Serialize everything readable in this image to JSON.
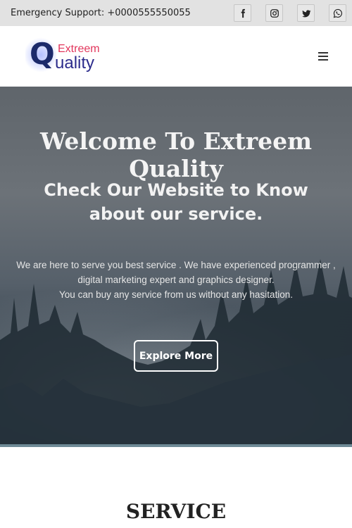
{
  "topbar": {
    "support_text": "Emergency Support: +0000555550055",
    "socials": [
      {
        "name": "facebook-icon"
      },
      {
        "name": "instagram-icon"
      },
      {
        "name": "twitter-icon"
      },
      {
        "name": "whatsapp-icon"
      }
    ]
  },
  "nav": {
    "logo": {
      "letter": "Q",
      "top": "Extreem",
      "bottom": "uality"
    },
    "menu_icon": "hamburger-icon"
  },
  "hero": {
    "title": "Welcome To Extreem Quality",
    "subtitle": "Check Our Website to Know about our service.",
    "desc_line1": "We are here to serve you best service . We have experienced programmer , digital marketing expert and graphics designer.",
    "desc_line2": "You can buy any service from us without any hasitation.",
    "button": "Explore More"
  },
  "service": {
    "title": "SERVICE"
  },
  "colors": {
    "topbar_bg": "#e2e2e2",
    "hero_accent_line": "#6e8a96",
    "logo_red": "#e2365c",
    "logo_blue": "#2c2c8c"
  }
}
